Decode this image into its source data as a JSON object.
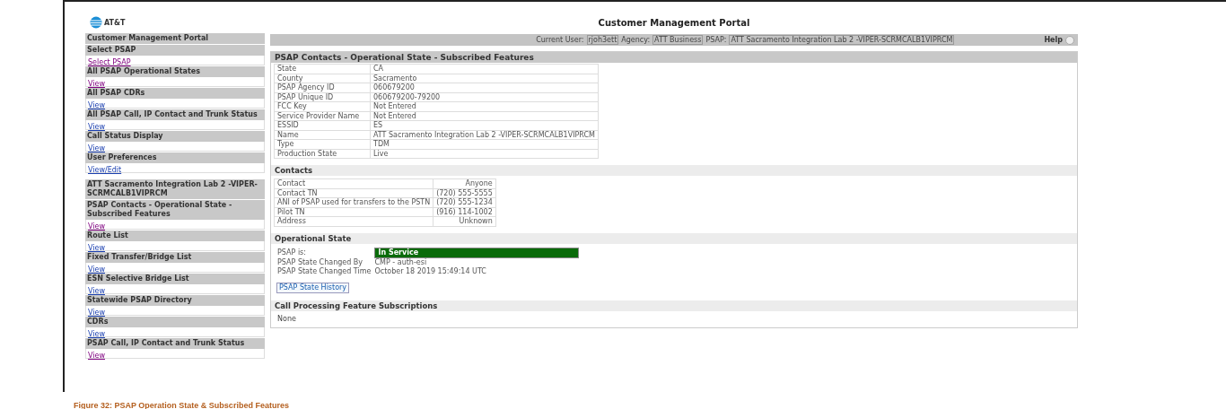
{
  "portal": {
    "logo_text": "AT&T",
    "title": "Customer Management Portal"
  },
  "sidebar": {
    "groups": [
      {
        "sections": [
          {
            "title": "Customer Management Portal"
          },
          {
            "title": "Select PSAP",
            "link": "Select PSAP",
            "visited": true
          },
          {
            "title": "All PSAP Operational States",
            "link": "View",
            "visited": true
          },
          {
            "title": "All PSAP CDRs",
            "link": "View",
            "visited": false
          },
          {
            "title": "All PSAP Call, IP Contact and Trunk Status",
            "link": "View",
            "visited": false
          },
          {
            "title": "Call Status Display",
            "link": "View",
            "visited": false
          },
          {
            "title": "User Preferences",
            "link": "View/Edit",
            "visited": false
          }
        ]
      },
      {
        "sections": [
          {
            "title": "ATT Sacramento Integration Lab 2 -VIPER-SCRMCALB1VIPRCM"
          },
          {
            "title": "PSAP Contacts - Operational State - Subscribed Features",
            "link": "View",
            "visited": true
          },
          {
            "title": "Route List",
            "link": "View",
            "visited": false
          },
          {
            "title": "Fixed Transfer/Bridge List",
            "link": "View",
            "visited": false
          },
          {
            "title": "ESN Selective Bridge List",
            "link": "View",
            "visited": false
          },
          {
            "title": "Statewide PSAP Directory",
            "link": "View",
            "visited": false
          },
          {
            "title": "CDRs",
            "link": "View",
            "visited": false
          },
          {
            "title": "PSAP Call, IP Contact and Trunk Status",
            "link": "View",
            "visited": true
          }
        ]
      }
    ]
  },
  "user_bar": {
    "items": [
      {
        "label": "Current User:",
        "value": "rjoh3ett"
      },
      {
        "label": "Agency:",
        "value": "ATT Business"
      },
      {
        "label": "PSAP:",
        "value": "ATT Sacramento Integration Lab 2 -VIPER-SCRMCALB1VIPRCM"
      }
    ],
    "help": "Help"
  },
  "panel": {
    "title": "PSAP Contacts - Operational State - Subscribed Features",
    "sections": [
      {
        "kind": "table",
        "rows": [
          {
            "label": "State",
            "value": "CA"
          },
          {
            "label": "County",
            "value": "Sacramento"
          },
          {
            "label": "PSAP Agency ID",
            "value": "060679200"
          },
          {
            "label": "PSAP Unique ID",
            "value": "060679200-79200"
          },
          {
            "label": "FCC Key",
            "value": "Not Entered"
          },
          {
            "label": "Service Provider Name",
            "value": "Not Entered"
          },
          {
            "label": "ESSID",
            "value": "ES"
          },
          {
            "label": "Name",
            "value": "ATT Sacramento Integration Lab 2 -VIPER-SCRMCALB1VIPRCM"
          },
          {
            "label": "Type",
            "value": "TDM"
          },
          {
            "label": "Production State",
            "value": "Live"
          }
        ]
      },
      {
        "kind": "table",
        "title": "Contacts",
        "right_aligned": true,
        "rows": [
          {
            "label": "Contact",
            "value": "Anyone"
          },
          {
            "label": "Contact TN",
            "value": "(720) 555-5555"
          },
          {
            "label": "ANI of PSAP used for transfers to the PSTN",
            "value": "(720) 555-1234"
          },
          {
            "label": "Pilot TN",
            "value": "(916) 114-1002"
          },
          {
            "label": "Address",
            "value": "Unknown"
          }
        ]
      },
      {
        "kind": "state",
        "title": "Operational State",
        "status": {
          "label": "PSAP is:",
          "value": "In Service",
          "in_service": true
        },
        "rows": [
          {
            "label": "PSAP State Changed By",
            "value": "CMP - auth-esi"
          },
          {
            "label": "PSAP State Changed Time",
            "value": "October 18 2019 15:49:14 UTC"
          }
        ],
        "button": "PSAP State History"
      },
      {
        "kind": "text",
        "title": "Call Processing Feature Subscriptions",
        "text": "None"
      }
    ]
  },
  "caption": "Figure 32: PSAP Operation State & Subscribed Features"
}
